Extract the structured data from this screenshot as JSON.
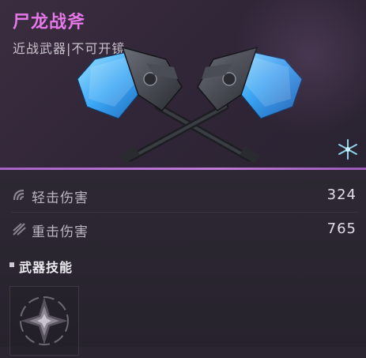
{
  "weapon": {
    "name": "尸龙战斧",
    "type_line": "近战武器|不可开镜",
    "rarity_icon": "snowflake-rarity-icon"
  },
  "stats": [
    {
      "label": "轻击伤害",
      "value": "324",
      "icon": "light-attack-icon"
    },
    {
      "label": "重击伤害",
      "value": "765",
      "icon": "heavy-attack-icon"
    }
  ],
  "skills": {
    "section_title": "武器技能",
    "skill_icon": "diamond-star-skill-icon"
  },
  "colors": {
    "title": "#e678ea",
    "accent_divider": "#b06ccc",
    "blade_glow": "#4fb6ff"
  }
}
